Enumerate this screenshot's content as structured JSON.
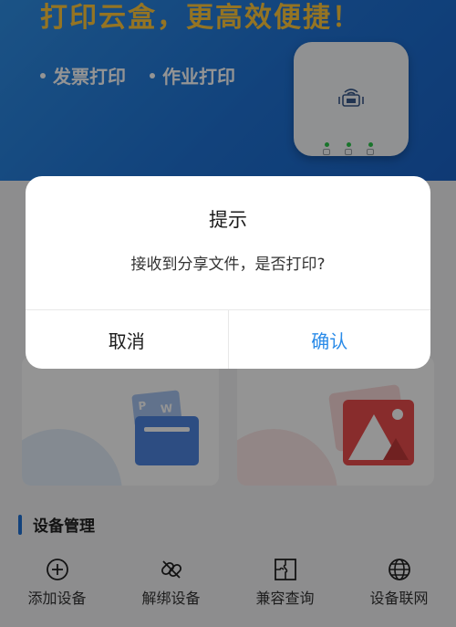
{
  "banner": {
    "title": "打印云盒，更高效便捷！",
    "features": [
      "发票打印",
      "作业打印"
    ],
    "brand_color": "#1f73d6",
    "title_color": "#ffc83d",
    "device_image": "cloud-print-box-device-icon"
  },
  "cards": [
    {
      "icon": "document-print-icon"
    },
    {
      "icon": "image-print-icon"
    }
  ],
  "device_management": {
    "title": "设备管理",
    "items": [
      {
        "label": "添加设备",
        "icon": "add-circle-icon"
      },
      {
        "label": "解绑设备",
        "icon": "unlink-icon"
      },
      {
        "label": "兼容查询",
        "icon": "puzzle-icon"
      },
      {
        "label": "设备联网",
        "icon": "globe-icon"
      }
    ]
  },
  "dialog": {
    "title": "提示",
    "message": "接收到分享文件，是否打印?",
    "cancel_label": "取消",
    "confirm_label": "确认",
    "confirm_color": "#2a8be8"
  }
}
